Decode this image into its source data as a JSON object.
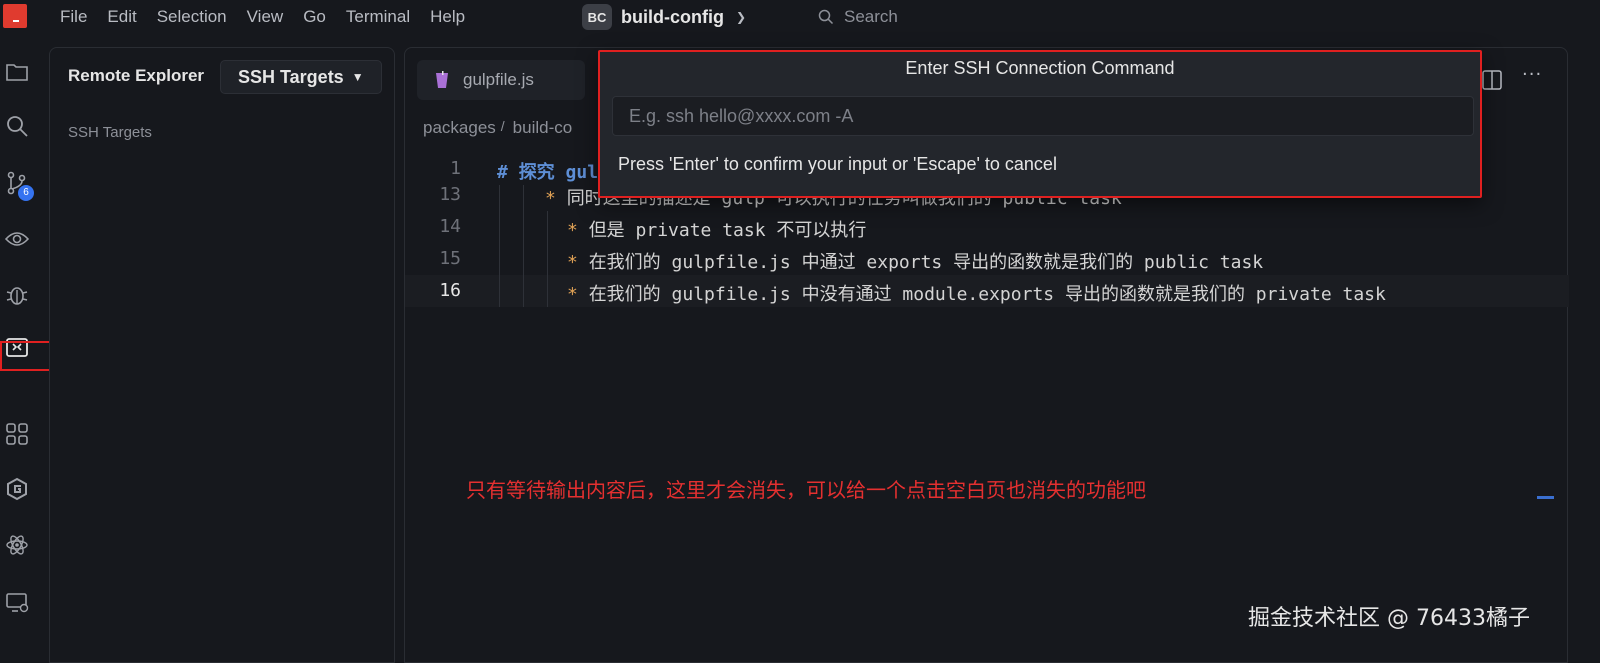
{
  "menu": [
    "File",
    "Edit",
    "Selection",
    "View",
    "Go",
    "Terminal",
    "Help"
  ],
  "project": {
    "badge": "BC",
    "name": "build-config"
  },
  "search": {
    "label": "Search"
  },
  "activity": {
    "scm_badge": "6"
  },
  "sidebar": {
    "title": "Remote Explorer",
    "dropdown": "SSH Targets",
    "section": "SSH Targets"
  },
  "editor": {
    "tab_label": "gulpfile.js",
    "breadcrumb": [
      "packages",
      "build-co"
    ],
    "lines": [
      {
        "num": "1",
        "hash": "# ",
        "text": "探究 gul"
      },
      {
        "num": "13",
        "bullet": "* ",
        "text": "同时这里的描述是 gulp 可以执行的任务叫做我们的 public task"
      },
      {
        "num": "14",
        "bullet": "* ",
        "text": "但是 private task 不可以执行"
      },
      {
        "num": "15",
        "bullet": "* ",
        "text": "在我们的 gulpfile.js 中通过 exports 导出的函数就是我们的 public task"
      },
      {
        "num": "16",
        "bullet": "* ",
        "text": "在我们的 gulpfile.js 中没有通过 module.exports 导出的函数就是我们的 private task"
      }
    ]
  },
  "quick_input": {
    "title": "Enter SSH Connection Command",
    "placeholder": "E.g. ssh hello@xxxx.com -A",
    "value": "",
    "message": "Press 'Enter' to confirm your input or 'Escape' to cancel"
  },
  "annotation": "只有等待输出内容后，这里才会消失，可以给一个点击空白页也消失的功能吧",
  "watermark": "掘金技术社区 @ 76433橘子",
  "colors": {
    "highlight": "#e02020",
    "accent": "#3573f0"
  }
}
